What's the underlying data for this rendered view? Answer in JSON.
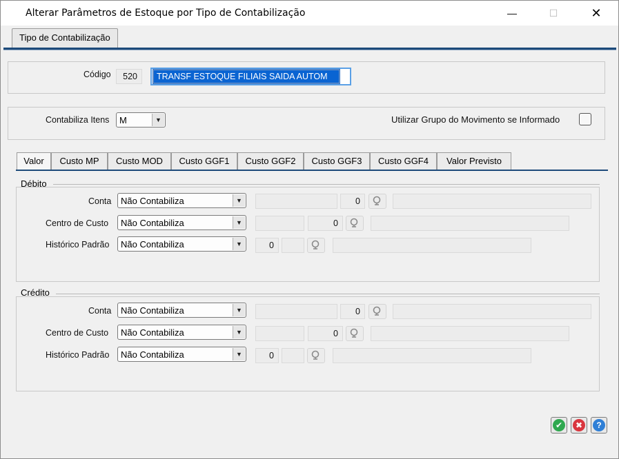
{
  "window": {
    "title": "Alterar Parâmetros de Estoque por Tipo de Contabilização",
    "minimize_glyph": "—",
    "maximize_glyph": "☐",
    "close_glyph": "✕"
  },
  "outer_tab": {
    "label": "Tipo de Contabilização"
  },
  "header": {
    "codigo_label": "Código",
    "codigo_value": "520",
    "descricao_value": "TRANSF ESTOQUE FILIAIS SAIDA AUTOM"
  },
  "options": {
    "contabiliza_label": "Contabiliza Itens",
    "contabiliza_value": "M",
    "grupo_label": "Utilizar Grupo do Movimento se Informado",
    "grupo_checked": false
  },
  "tabs": [
    {
      "label": "Valor"
    },
    {
      "label": "Custo MP"
    },
    {
      "label": "Custo MOD"
    },
    {
      "label": "Custo GGF1"
    },
    {
      "label": "Custo GGF2"
    },
    {
      "label": "Custo GGF3"
    },
    {
      "label": "Custo GGF4"
    },
    {
      "label": "Valor Previsto"
    }
  ],
  "debito": {
    "title": "Débito",
    "conta_label": "Conta",
    "conta_value": "Não Contabiliza",
    "conta_num": "0",
    "centro_label": "Centro de Custo",
    "centro_value": "Não Contabiliza",
    "centro_num": "0",
    "historico_label": "Histórico Padrão",
    "historico_value": "Não Contabiliza",
    "historico_num": "0"
  },
  "credito": {
    "title": "Crédito",
    "conta_label": "Conta",
    "conta_value": "Não Contabiliza",
    "conta_num": "0",
    "centro_label": "Centro de Custo",
    "centro_value": "Não Contabiliza",
    "centro_num": "0",
    "historico_label": "Histórico Padrão",
    "historico_value": "Não Contabiliza",
    "historico_num": "0"
  },
  "buttons": {
    "ok_glyph": "✔",
    "cancel_glyph": "✖",
    "help_glyph": "?"
  },
  "colors": {
    "accent": "#1d4a7a",
    "selection": "#0a64d2",
    "ok": "#2fa84f",
    "cancel": "#d9363e",
    "help": "#2f7fd6"
  },
  "icons": {
    "arrow": "▼",
    "search": "search-icon"
  }
}
